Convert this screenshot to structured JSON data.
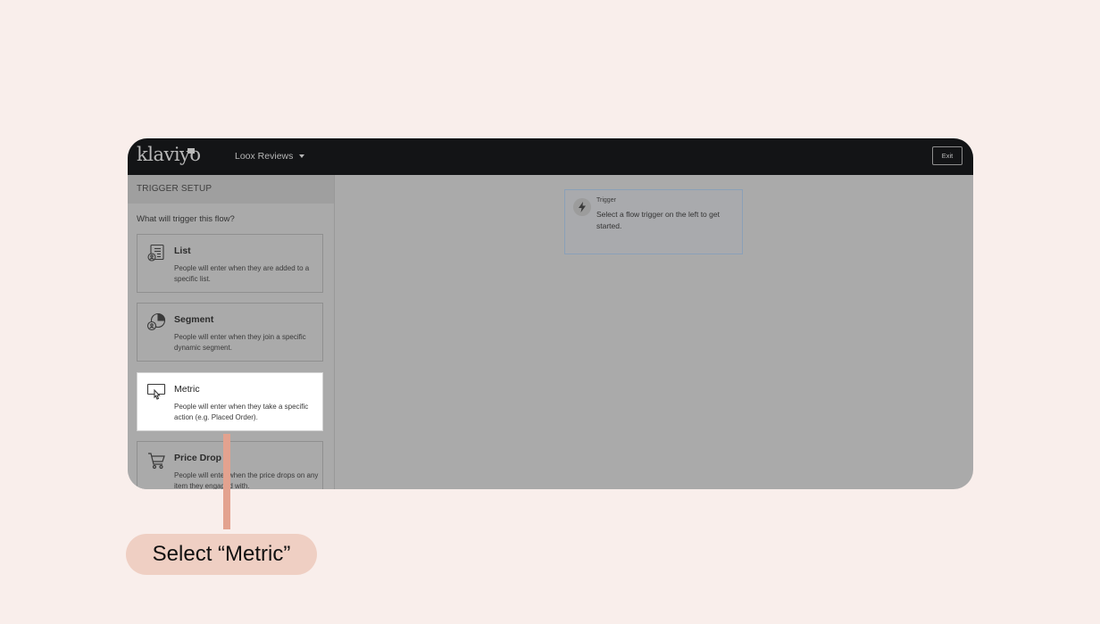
{
  "app": {
    "logo_text": "klaviyo",
    "account_name": "Loox Reviews",
    "exit_label": "Exit"
  },
  "sidebar": {
    "header": "TRIGGER SETUP",
    "question": "What will trigger this flow?",
    "cards": [
      {
        "title": "List",
        "description": "People will enter when they are added to a specific list.",
        "icon": "list-icon"
      },
      {
        "title": "Segment",
        "description": "People will enter when they join a specific dynamic segment.",
        "icon": "segment-pie-icon"
      },
      {
        "title": "Metric",
        "description": "People will enter when they take a specific action (e.g. Placed Order).",
        "icon": "metric-click-icon",
        "selected": true
      },
      {
        "title": "Price Drop",
        "description": "People will enter when the price drops on any item they engaged with.",
        "icon": "cart-icon"
      }
    ]
  },
  "canvas": {
    "trigger_label": "Trigger",
    "trigger_text": "Select a flow trigger on the left to get started.",
    "trigger_icon": "lightning-icon"
  },
  "annotation": {
    "callout_text": "Select “Metric”",
    "color": "#e3a28f"
  }
}
